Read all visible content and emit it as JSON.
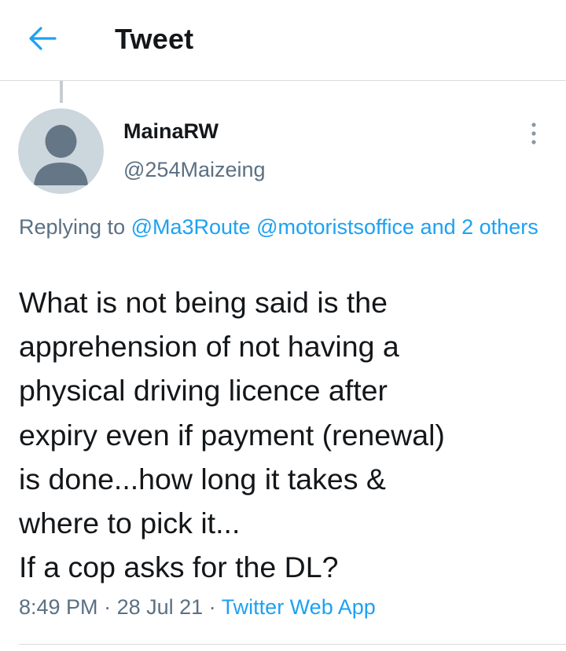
{
  "header": {
    "title": "Tweet",
    "back_icon": "arrow-left-icon"
  },
  "tweet": {
    "display_name": "MainaRW",
    "handle": "@254Maizeing",
    "avatar_icon": "default-avatar-icon",
    "more_icon": "vertical-ellipsis-icon",
    "replying": {
      "prefix": "Replying to ",
      "mention_1": "@Ma3Route",
      "mention_2": "@motoristsoffice",
      "others": "and 2 others"
    },
    "text": "What is not being said is the\napprehension of not having a\nphysical driving licence after\nexpiry even if payment (renewal)\nis done...how long it takes &\nwhere to pick it...\nIf a cop asks for the DL?",
    "time": "8:49 PM",
    "separator": " · ",
    "date": "28 Jul 21",
    "source": "Twitter Web App"
  },
  "colors": {
    "accent": "#1da1f2",
    "text_primary": "#14171a",
    "text_secondary": "#5b7083",
    "divider": "#dcdcdc",
    "avatar_bg": "#ccd6dd",
    "avatar_fg": "#657786"
  }
}
